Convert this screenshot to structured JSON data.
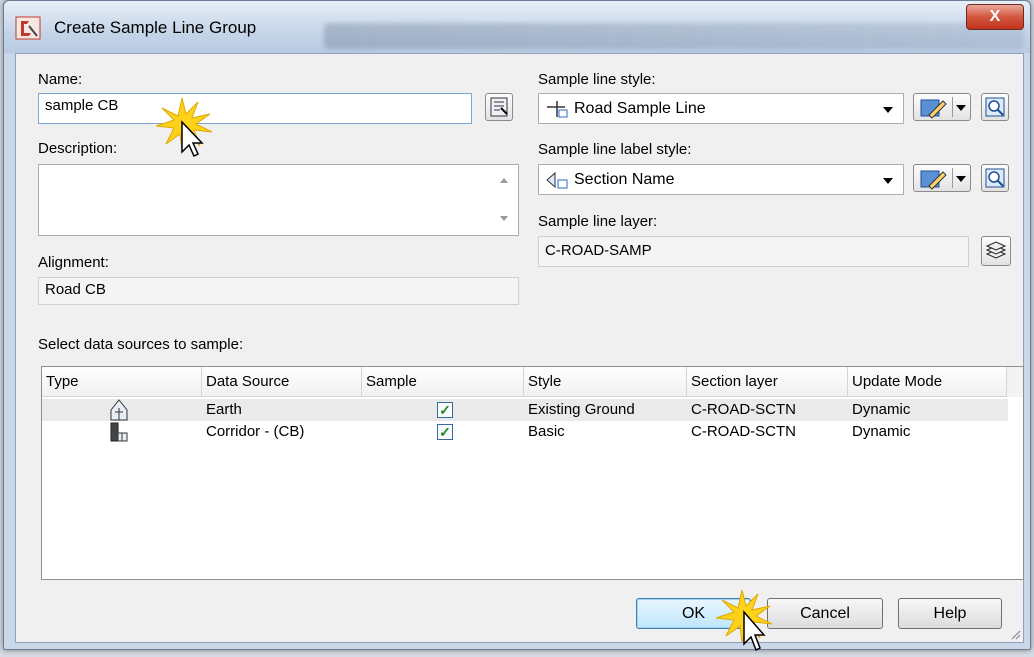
{
  "window": {
    "title": "Create Sample Line Group",
    "close_label": "X"
  },
  "name": {
    "label": "Name:",
    "value": "sample CB"
  },
  "description": {
    "label": "Description:",
    "value": ""
  },
  "alignment": {
    "label": "Alignment:",
    "value": "Road CB"
  },
  "sample_line_style": {
    "label": "Sample line style:",
    "value": "Road Sample Line"
  },
  "sample_line_label_style": {
    "label": "Sample line label style:",
    "value": "Section Name"
  },
  "sample_line_layer": {
    "label": "Sample line layer:",
    "value": "C-ROAD-SAMP"
  },
  "data_sources": {
    "label": "Select data sources to sample:",
    "columns": [
      "Type",
      "Data Source",
      "Sample",
      "Style",
      "Section layer",
      "Update Mode"
    ],
    "rows": [
      {
        "type_icon": "surface-icon",
        "source": "Earth",
        "sample": true,
        "style": "Existing Ground",
        "layer": "C-ROAD-SCTN",
        "mode": "Dynamic"
      },
      {
        "type_icon": "corridor-icon",
        "source": "Corridor - (CB)",
        "sample": true,
        "style": "Basic",
        "layer": "C-ROAD-SCTN",
        "mode": "Dynamic"
      }
    ]
  },
  "buttons": {
    "ok": "OK",
    "cancel": "Cancel",
    "help": "Help"
  },
  "colors": {
    "accent": "#3c7fb1",
    "check": "#1d8a1d",
    "close": "#c2331c",
    "highlight": "#ffd21a"
  }
}
